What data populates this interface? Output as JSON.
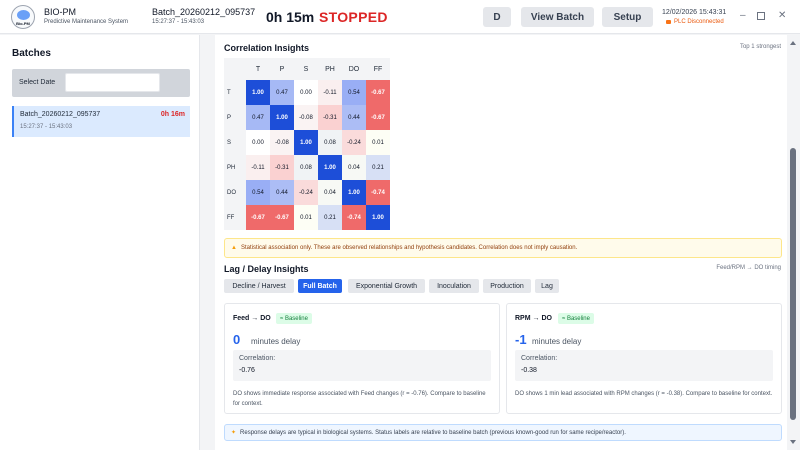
{
  "header": {
    "logo_text": "Bio-PM",
    "app_name": "BIO-PM",
    "app_subtitle": "Predictive Maintenance System",
    "batch_name": "Batch_20260212_095737",
    "batch_time": "15:27:37 - 15:43:03",
    "runtime": "0h 15m",
    "status": "STOPPED",
    "buttons": {
      "d": "D",
      "view_batch": "View Batch",
      "setup": "Setup"
    },
    "datetime": "12/02/2026 15:43:31",
    "plc_status": "PLC Disconnected",
    "window_controls": {
      "minimize": "–",
      "close": "✕"
    }
  },
  "sidebar": {
    "title": "Batches",
    "date_label": "Select Date",
    "date_value": "",
    "items": [
      {
        "name": "Batch_20260212_095737",
        "duration": "0h 16m",
        "time": "15:27:37 - 15:43:03"
      }
    ]
  },
  "correlation": {
    "title": "Correlation Insights",
    "right_label": "Top 1 strongest",
    "variables": [
      "T",
      "P",
      "S",
      "PH",
      "DO",
      "FF"
    ],
    "matrix": [
      [
        "1.00",
        "0.47",
        "0.00",
        "-0.11",
        "0.54",
        "-0.67"
      ],
      [
        "0.47",
        "1.00",
        "-0.08",
        "-0.31",
        "0.44",
        "-0.67"
      ],
      [
        "0.00",
        "-0.08",
        "1.00",
        "0.08",
        "-0.24",
        "0.01"
      ],
      [
        "-0.11",
        "-0.31",
        "0.08",
        "1.00",
        "0.04",
        "0.21"
      ],
      [
        "0.54",
        "0.44",
        "-0.24",
        "0.04",
        "1.00",
        "-0.74"
      ],
      [
        "-0.67",
        "-0.67",
        "0.01",
        "0.21",
        "-0.74",
        "1.00"
      ]
    ],
    "disclaimer": "Statistical association only. These are observed relationships and hypothesis candidates. Correlation does not imply causation."
  },
  "lag": {
    "title": "Lag / Delay Insights",
    "right_label": "Feed/RPM → DO timing",
    "tabs": [
      "Decline / Harvest",
      "Full Batch",
      "Exponential Growth",
      "Inoculation",
      "Production",
      "Lag"
    ],
    "active_tab": "Full Batch",
    "cards": [
      {
        "title": "Feed → DO",
        "badge": "≈ Baseline",
        "value": "0",
        "unit": "minutes delay",
        "corr_label": "Correlation:",
        "corr_value": "-0.76",
        "description": "DO shows immediate response associated with Feed changes (r = -0.76). Compare to baseline for context."
      },
      {
        "title": "RPM → DO",
        "badge": "≈ Baseline",
        "value": "-1",
        "unit": "minutes delay",
        "corr_label": "Correlation:",
        "corr_value": "-0.38",
        "description": "DO shows 1 min lead associated with RPM changes (r = -0.38). Compare to baseline for context."
      }
    ],
    "info_note": "Response delays are typical in biological systems. Status labels are relative to baseline batch (previous known-good run for same recipe/reactor)."
  },
  "colors": {
    "accent": "#2563eb",
    "danger": "#dc2626",
    "warning": "#f97316",
    "positive_strong": "#1d4ed8",
    "negative_strong": "#ef4444"
  }
}
